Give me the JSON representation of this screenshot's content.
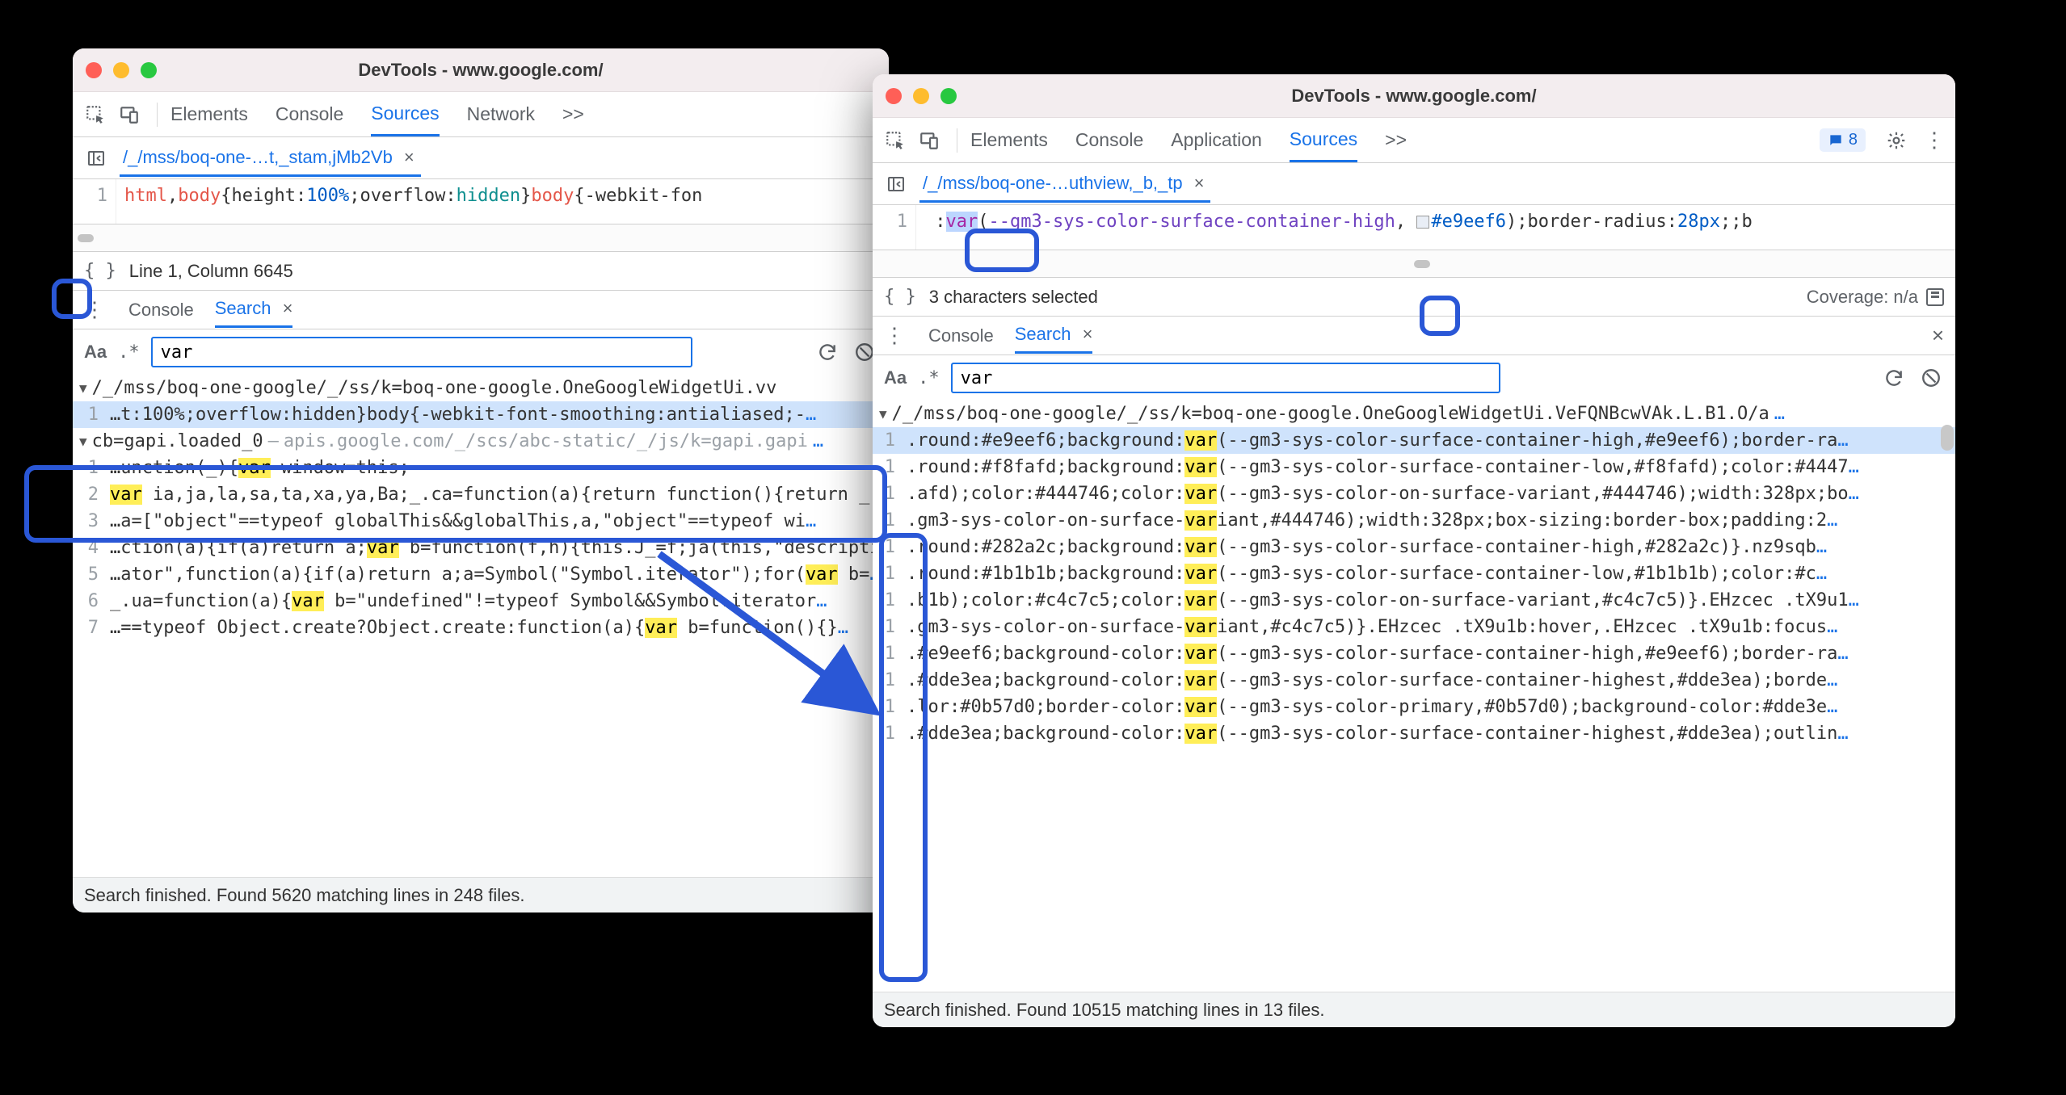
{
  "left": {
    "title": "DevTools - www.google.com/",
    "tabs": [
      "Elements",
      "Console",
      "Sources",
      "Network"
    ],
    "active_tab": "Sources",
    "more_tabs_glyph": ">>",
    "file_tab": "/_/mss/boq-one-…t,_stam,jMb2Vb",
    "code": {
      "line_no": "1",
      "parts": {
        "sel1": "html",
        "sel2": "body",
        "p1": "height",
        "v1a": "100",
        "v1b": "%",
        "p2": "overflow",
        "v2": "hidden",
        "sel3": "body",
        "tail": "{-webkit-fon"
      }
    },
    "status": "Line 1, Column 6645",
    "drawer": {
      "tabs": [
        "Console",
        "Search"
      ],
      "active": "Search"
    },
    "search": {
      "aa": "Aa",
      "regex": ".*",
      "value": "var"
    },
    "result_files": [
      {
        "header": "/_/mss/boq-one-google/_/ss/k=boq-one-google.OneGoogleWidgetUi.vv",
        "rows": [
          {
            "n": "1",
            "pre": "…t:100%;overflow:hidden}body{-webkit-font-smoothing:antialiased;-",
            "hl": "",
            "post": "",
            "ell": true,
            "selected": true
          }
        ]
      },
      {
        "header": "cb=gapi.loaded_0",
        "header_src": "apis.google.com/_/scs/abc-static/_/js/k=gapi.gapi",
        "header_ell": true,
        "rows": [
          {
            "n": "1",
            "pre": "…unction(_){",
            "hl": "var",
            "post": " window=this;"
          },
          {
            "n": "2",
            "pre": "",
            "hl": "var",
            "post": " ia,ja,la,sa,ta,xa,ya,Ba;_.ca=function(a){return function(){return _.ba",
            "ell": true
          },
          {
            "n": "3",
            "pre": "…a=[\"object\"==typeof globalThis&&globalThis,a,\"object\"==typeof wi",
            "hl": "",
            "post": "",
            "ell": true
          },
          {
            "n": "4",
            "pre": "…ction(a){if(a)return a;",
            "hl": "var",
            "post": " b=function(f,h){this.J_=f;ja(this,\"description\"",
            "ell": true
          },
          {
            "n": "5",
            "pre": "…ator\",function(a){if(a)return a;a=Symbol(\"Symbol.iterator\");for(",
            "hl": "var",
            "post": " b=",
            "ell": true
          },
          {
            "n": "6",
            "pre": "_.ua=function(a){",
            "hl": "var",
            "post": " b=\"undefined\"!=typeof Symbol&&Symbol.iterator",
            "ell": true
          },
          {
            "n": "7",
            "pre": "…==typeof Object.create?Object.create:function(a){",
            "hl": "var",
            "post": " b=function(){}",
            "ell": true
          }
        ]
      }
    ],
    "footer": "Search finished.  Found 5620 matching lines in 248 files."
  },
  "right": {
    "title": "DevTools - www.google.com/",
    "tabs": [
      "Elements",
      "Console",
      "Application",
      "Sources"
    ],
    "active_tab": "Sources",
    "more_tabs_glyph": ">>",
    "issues_count": "8",
    "file_tab": "/_/mss/boq-one-…uthview,_b,_tp",
    "code": {
      "line_no": "1",
      "pre_colon": ":",
      "var_kw": "var",
      "after_var": "(",
      "varname": "--gm3-sys-color-surface-container-high",
      "hex": "#e9eef6",
      "between": ", ",
      "close": ")",
      "p2": "border-radius",
      "v2": "28",
      "v2u": "px",
      "tail": ";b"
    },
    "status_left": "3 characters selected",
    "status_right": "Coverage: n/a",
    "drawer": {
      "tabs": [
        "Console",
        "Search"
      ],
      "active": "Search"
    },
    "search": {
      "aa": "Aa",
      "regex": ".*",
      "value": "var"
    },
    "result_header": "/_/mss/boq-one-google/_/ss/k=boq-one-google.OneGoogleWidgetUi.VeFQNBcwVAk.L.B1.O/a",
    "rows": [
      {
        "n": "1",
        "pre": ".round:#e9eef6;background:",
        "hl": "var",
        "post": "(--gm3-sys-color-surface-container-high,#e9eef6);border-ra"
      },
      {
        "n": "1",
        "pre": ".round:#f8fafd;background:",
        "hl": "var",
        "post": "(--gm3-sys-color-surface-container-low,#f8fafd);color:#4447"
      },
      {
        "n": "1",
        "pre": ".afd);color:#444746;color:",
        "hl": "var",
        "post": "(--gm3-sys-color-on-surface-variant,#444746);width:328px;bo"
      },
      {
        "n": "1",
        "pre": ".gm3-sys-color-on-surface-",
        "hl": "var",
        "post": "iant,#444746);width:328px;box-sizing:border-box;padding:2"
      },
      {
        "n": "1",
        "pre": ".round:#282a2c;background:",
        "hl": "var",
        "post": "(--gm3-sys-color-surface-container-high,#282a2c)}.nz9sqb"
      },
      {
        "n": "1",
        "pre": ".round:#1b1b1b;background:",
        "hl": "var",
        "post": "(--gm3-sys-color-surface-container-low,#1b1b1b);color:#c"
      },
      {
        "n": "1",
        "pre": ".b1b);color:#c4c7c5;color:",
        "hl": "var",
        "post": "(--gm3-sys-color-on-surface-variant,#c4c7c5)}.EHzcec .tX9u1"
      },
      {
        "n": "1",
        "pre": ".gm3-sys-color-on-surface-",
        "hl": "var",
        "post": "iant,#c4c7c5)}.EHzcec .tX9u1b:hover,.EHzcec .tX9u1b:focus"
      },
      {
        "n": "1",
        "pre": ".#e9eef6;background-color:",
        "hl": "var",
        "post": "(--gm3-sys-color-surface-container-high,#e9eef6);border-ra"
      },
      {
        "n": "1",
        "pre": ".#dde3ea;background-color:",
        "hl": "var",
        "post": "(--gm3-sys-color-surface-container-highest,#dde3ea);borde"
      },
      {
        "n": "1",
        "pre": ".lor:#0b57d0;border-color:",
        "hl": "var",
        "post": "(--gm3-sys-color-primary,#0b57d0);background-color:#dde3e"
      },
      {
        "n": "1",
        "pre": ".#dde3ea;background-color:",
        "hl": "var",
        "post": "(--gm3-sys-color-surface-container-highest,#dde3ea);outlin"
      }
    ],
    "footer": "Search finished.  Found 10515 matching lines in 13 files."
  }
}
